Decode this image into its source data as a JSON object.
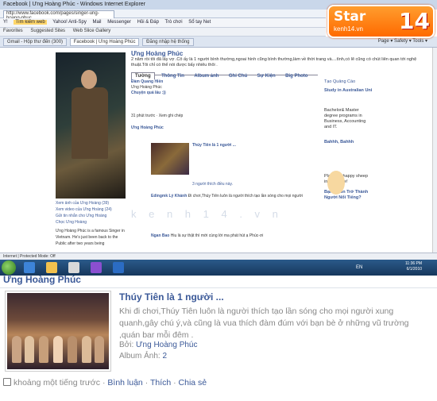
{
  "browser": {
    "title": "Facebook | Ưng Hoàng Phúc - Windows Internet Explorer",
    "address": "http://www.facebook.com/pages/singer-ung-hoang-phuc",
    "toolbar_items": [
      "Y!",
      "Tìm kiếm web",
      "Yahoo! Anti-Spy",
      "Mail",
      "Messenger",
      "Hỏi & Đáp",
      "Trò chơi",
      "Sổ tay Net"
    ],
    "favorites": [
      "Favorites",
      "Suggested Sites",
      "Web Slice Gallery"
    ],
    "tabs": [
      "Gmail - Hộp thư đến (300)",
      "Facebook | Ưng Hoàng Phúc",
      "Đăng nhập hệ thống"
    ],
    "tab_right": "Page ▾  Safety ▾  Tools ▾"
  },
  "logo": {
    "star": "Star",
    "site": "kenh14.vn",
    "num": "14"
  },
  "profile": {
    "name": "Ưng Hoàng Phúc",
    "status": "2 năm rồi tôi đã lấy vợ .Cô ấy là 1 người bình thường,ngoai hình cũng bình thường,làm về thời trang và....tình,có lẽ cũng có chút liên quan tới nghệ thuật.Tôi chỉ có thể nói được bấy nhiêu thôi .",
    "tabs": [
      "Tường",
      "Thông Tin",
      "Album ảnh",
      "Ghi Chú",
      "Sự Kiện",
      "Big Photo"
    ],
    "left_links": [
      "Xem ảnh của Ưng Hoàng (39)",
      "Xem video của Ưng Hoàng (24)",
      "Gửi tin nhắn cho Ưng Hoàng",
      "Chọc Ưng Hoàng"
    ],
    "bio": "Ưng Hoàng Phúc is a famous Singer in Vietnam. He's just been back to the Public after two years being",
    "feed1_user": "Đàm Quang Hiền",
    "feed1_to": "Ưng Hoàng Phúc",
    "feed1_title": "Chuyện quá lâu :))",
    "feed1_time": "31 phút trước · Xem ghi chép",
    "small_title": "Thúy Tiên là 1 người ...",
    "likes": "3 người thích điều này.",
    "c1_user": "Edingmk Lý Khánh",
    "c1_text": "Đi chơi,Thúy Tiên luôn là người thích tạo lần sóng cho mọi người",
    "c2_user": "Ngan Bao",
    "c2_text": "Hiu là sự thật thì mời cùng lời ma phát hút ạ Phúc-ơi",
    "watermark": "k e n h 1 4 . v n"
  },
  "rside": {
    "ad_label": "Tạo Quảng Cáo",
    "study": "Study in Australian Uni",
    "bach": "Bachelor& Master degree programs in Business, Accounting and IT.",
    "bahh": "Bahhh, Bahhh",
    "farm": "Play with happy sheep in Farmville!",
    "fan": "Bạn Muốn Trở Thành Người Nổi Tiếng?"
  },
  "statusbar": "Internet | Protected Mode: Off",
  "taskbar": {
    "lang": "EN",
    "time": "11:36 PM",
    "date": "6/1/2010"
  },
  "zoom": {
    "name": "Ưng Hoàng Phúc",
    "post_title": "Thúy Tiên là 1 người ...",
    "post_desc": "Khi đi chơi,Thúy Tiên luôn là người thích tạo lần sóng cho mọi người xung quanh,gây chú ý,và cũng là vua thích đàm đúm với bạn bè ở những vũ trường ,quán bar mỗi đêm .",
    "by_label": "Bởi:",
    "by_name": "Ưng Hoàng Phúc",
    "album_label": "Album Ảnh:",
    "album_value": "2",
    "time": "khoảng một tiếng trước",
    "sep": "·",
    "comment": "Bình luận",
    "like": "Thích",
    "share": "Chia sẻ"
  }
}
